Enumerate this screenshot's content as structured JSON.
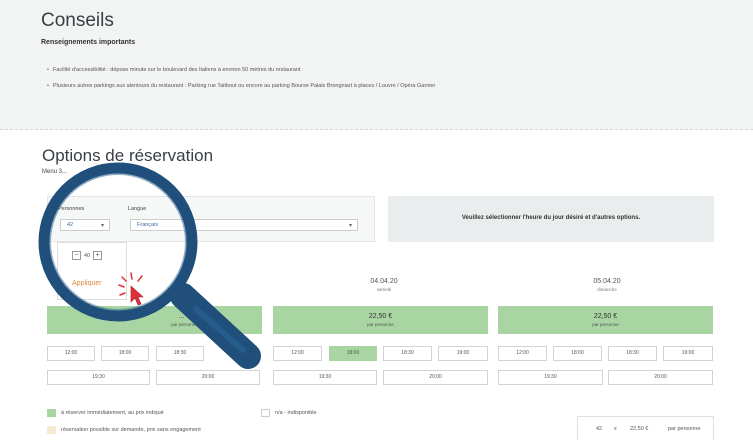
{
  "conseils": {
    "title": "Conseils",
    "subtitle": "Renseignements importants",
    "items": [
      "Facilité d'accessibilité : dépose minute sur le boulevard des Italiens à environ 50 mètres du restaurant",
      "Plusieurs autres parkings aux alentours du restaurant : Parking rue Taitbout ou encore au parking Bourse Palais Brongniart à places / Louvre / Opéra Garnier"
    ]
  },
  "options": {
    "title": "Options de réservation",
    "menu_sub": "Menu 3..."
  },
  "filters": {
    "persons_label": "Personnes",
    "persons_value": "42",
    "language_label": "Langue",
    "language_value": "Français",
    "stepper_value": "40",
    "apply_label": "Appliquer"
  },
  "info_message": "Veuillez sélectionner l'heure du jour désiré et d'autres options.",
  "days": [
    {
      "date": "",
      "weekday": "",
      "price": "... €",
      "per": "par personne",
      "slots_row1": [
        "12:00",
        "18:00",
        "18:30",
        ""
      ],
      "slots_row2": [
        "19:30",
        "20:00"
      ]
    },
    {
      "date": "04.04.20",
      "weekday": "samedi",
      "price": "22,50 €",
      "per": "par personne",
      "slots_row1": [
        "12:00",
        "18:00",
        "18:30",
        "19:00"
      ],
      "slots_row2": [
        "19:30",
        "20:00"
      ]
    },
    {
      "date": "05.04.20",
      "weekday": "dimanche",
      "price": "22,50 €",
      "per": "par personne",
      "slots_row1": [
        "12:00",
        "18:00",
        "18:30",
        "19:00"
      ],
      "slots_row2": [
        "19:30",
        "20:00"
      ]
    }
  ],
  "legend": {
    "immediate": "à réserver immédiatement, au prix indiqué",
    "on_request": "réservation possible sur demande, prix sans engagement",
    "unavailable": "n/a - indisponible"
  },
  "summary": {
    "qty": "42",
    "times": "x",
    "unit_price": "22,50 €",
    "per": "par personne"
  },
  "colors": {
    "accent_green": "#a8d5a2",
    "apply_orange": "#e08a3a",
    "magnifier_blue": "#1f4f7a",
    "cursor_red": "#e0313a"
  },
  "icons": {
    "magnifier": "magnifying-glass-icon",
    "click": "click-burst-icon"
  }
}
